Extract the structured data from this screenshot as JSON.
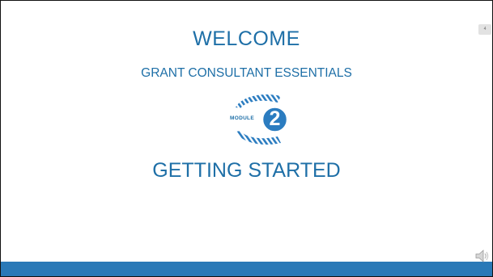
{
  "slide": {
    "title": "WELCOME",
    "subtitle": "GRANT CONSULTANT ESSENTIALS",
    "module_word": "MODULE",
    "module_number": "2",
    "heading": "GETTING STARTED",
    "page_number": "4"
  },
  "icons": {
    "module_badge": "module-badge-icon",
    "speaker": "speaker-icon"
  },
  "colors": {
    "accent": "#1e6fa7",
    "footer_bar": "#2a79b7",
    "badge_circle": "#2b7cc0"
  }
}
